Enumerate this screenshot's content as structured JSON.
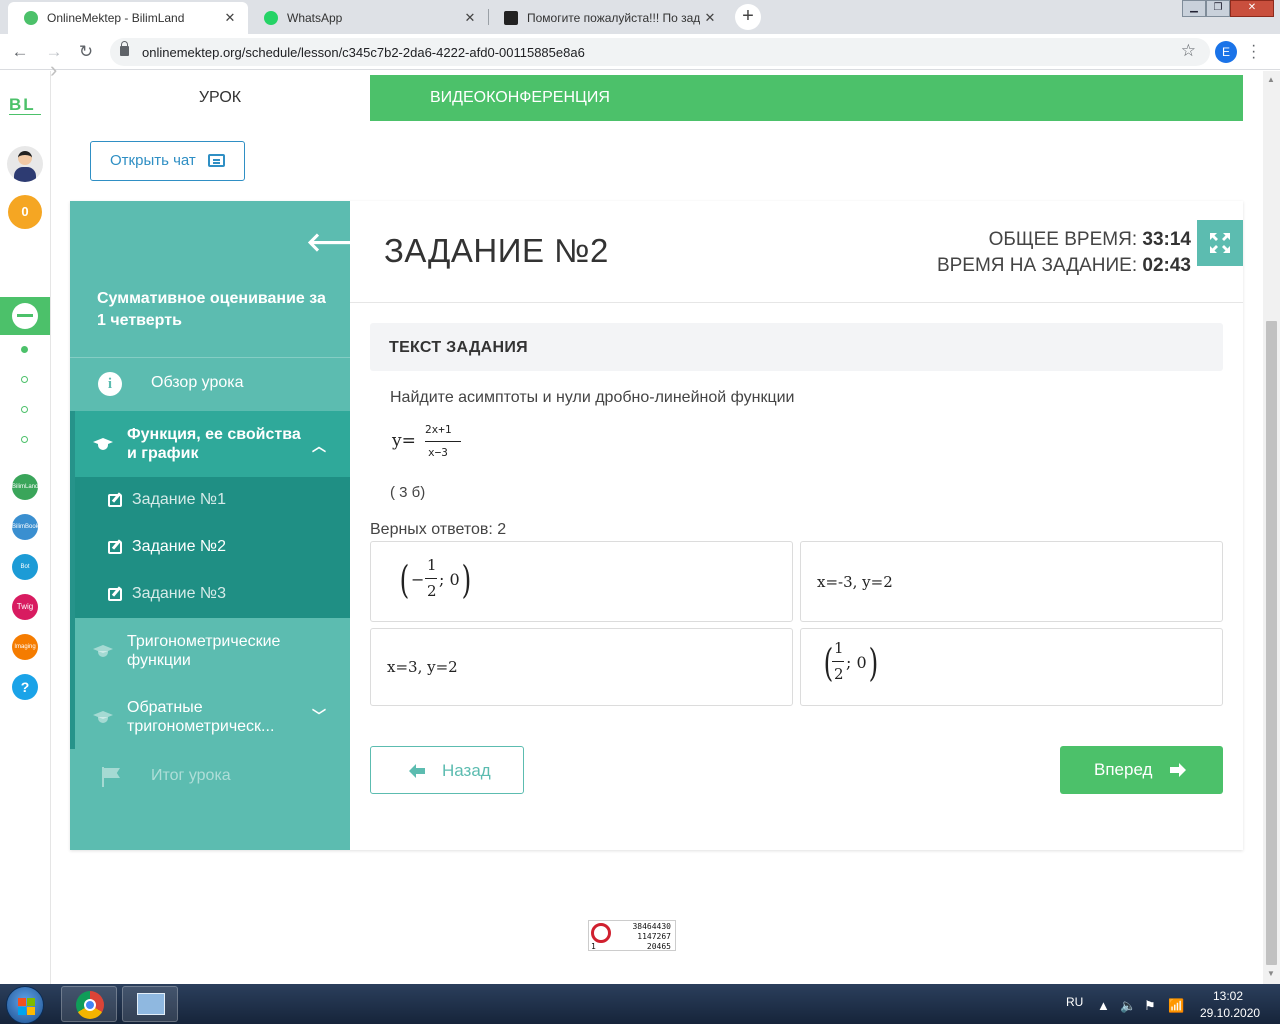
{
  "browser": {
    "tabs": [
      {
        "title": "OnlineMektep - BilimLand",
        "favicon_color": "#4cc16a",
        "active": true
      },
      {
        "title": "WhatsApp",
        "favicon_color": "#25d366",
        "active": false
      },
      {
        "title": "Помогите пожалуйста!!! По зад",
        "favicon_color": "#222222",
        "active": false
      }
    ],
    "close_symbol": "✕",
    "new_tab_symbol": "+",
    "url": "onlinemektep.org/schedule/lesson/c345c7b2-2da6-4222-afd0-00115885e8a6",
    "profile_initial": "E"
  },
  "rail": {
    "logo": "BL",
    "coins": "0",
    "apps": [
      {
        "label": "BilimLand",
        "color": "#3aa55a"
      },
      {
        "label": "BilimBook",
        "color": "#3a8fd0"
      },
      {
        "label": "Bot",
        "color": "#1c9bd6"
      },
      {
        "label": "Twig",
        "color": "#d81b60"
      },
      {
        "label": "Imaging",
        "color": "#f57c00"
      },
      {
        "label": "?",
        "color": "#1aa3e8"
      }
    ]
  },
  "tabs": {
    "lesson": "УРОК",
    "videoconference": "ВИДЕОКОНФЕРЕНЦИЯ"
  },
  "chat_button": "Открыть чат",
  "sidebar": {
    "course_title": "Суммативное оценивание за 1 четверть",
    "overview": "Обзор урока",
    "active_section": "Функция, ее свойства и график",
    "subitems": [
      "Задание №1",
      "Задание №2",
      "Задание №3"
    ],
    "current_subitem_index": 1,
    "section_trig": "Тригонометрические функции",
    "section_inverse": "Обратные тригонометрическ...",
    "final": "Итог урока"
  },
  "task": {
    "title": "ЗАДАНИЕ №2",
    "total_time_label": "ОБЩЕЕ ВРЕМЯ:",
    "total_time": "33:14",
    "task_time_label": "ВРЕМЯ НА ЗАДАНИЕ:",
    "task_time": "02:43",
    "header": "ТЕКСТ ЗАДАНИЯ",
    "question": "Найдите асимптоты и нули дробно-линейной функции",
    "formula_lhs": "y=",
    "formula_num": "2x+1",
    "formula_den": "x−3",
    "points": "( 3 б)",
    "correct_count": "Верных ответов: 2"
  },
  "answers": {
    "a1": {
      "minus": "−",
      "num": "1",
      "den": "2",
      "rest": "; 0"
    },
    "a2": "x=-3, y=2",
    "a3": "x=3, y=2",
    "a4": {
      "num": "1",
      "den": "2",
      "rest": "; 0"
    }
  },
  "nav": {
    "back": "Назад",
    "next": "Вперед"
  },
  "counter": {
    "line1": "38464430",
    "line2": "1147267",
    "line3": "20465",
    "left": "1"
  },
  "taskbar": {
    "lang": "RU",
    "time": "13:02",
    "date": "29.10.2020"
  }
}
